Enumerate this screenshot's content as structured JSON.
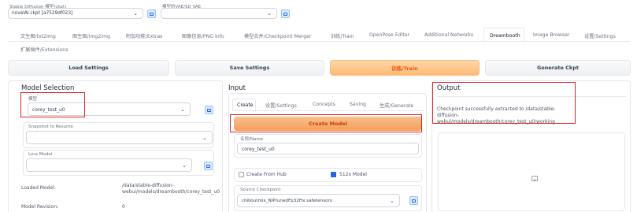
{
  "top": {
    "checkpoint_label": "Stable Diffusion 模型(ckpt)",
    "checkpoint_value": "novelAI.ckpt [a7529df023]",
    "vae_label": "模型的VAE/SD VAE",
    "vae_value": ""
  },
  "tabs": [
    "文生图/txt2img",
    "图生图/img2img",
    "附加功能/Extras",
    "图像信息/PNG Info",
    "模型合并/Checkpoint Merger",
    "训练/Train",
    "OpenPose Editor",
    "Additional Networks",
    "Dreambooth",
    "Image Browser",
    "设置/Settings",
    "扩展插件/Extensions"
  ],
  "actions": {
    "load": "Load Settings",
    "save": "Save Settings",
    "train": "训练/Train",
    "generate": "Generate Ckpt"
  },
  "model_selection": {
    "title": "Model Selection",
    "model_label": "模型",
    "model_value": "corey_test_u0",
    "snapshot_label": "Snapshot to Resume",
    "snapshot_value": "",
    "lora_label": "Lora Model",
    "lora_value": "",
    "loaded_label": "Loaded Model:",
    "loaded_value": "/data/stable-diffusion-webui/models/dreambooth/corey_test_u0",
    "revision_label": "Model Revision:",
    "revision_value": "0"
  },
  "input": {
    "title": "Input",
    "subtabs": [
      "Create",
      "设置/Settings",
      "Concepts",
      "Saving",
      "生成/Generate"
    ],
    "create_button": "Create Model",
    "name_label": "名称/Name",
    "name_value": "corey_test_u0",
    "from_hub_label": "Create From Hub",
    "model512_label": "512x Model",
    "source_label": "Source Checkpoint",
    "source_value": "chilloutmix_NiPrunedFp32Fix.safetensors"
  },
  "output": {
    "title": "Output",
    "message": "Checkpoint successfully extracted to /data/stable-diffusion-webui/models/dreambooth/corey_test_u0/working"
  },
  "colors": {
    "accent": "#f97316",
    "highlight": "#e02424"
  }
}
